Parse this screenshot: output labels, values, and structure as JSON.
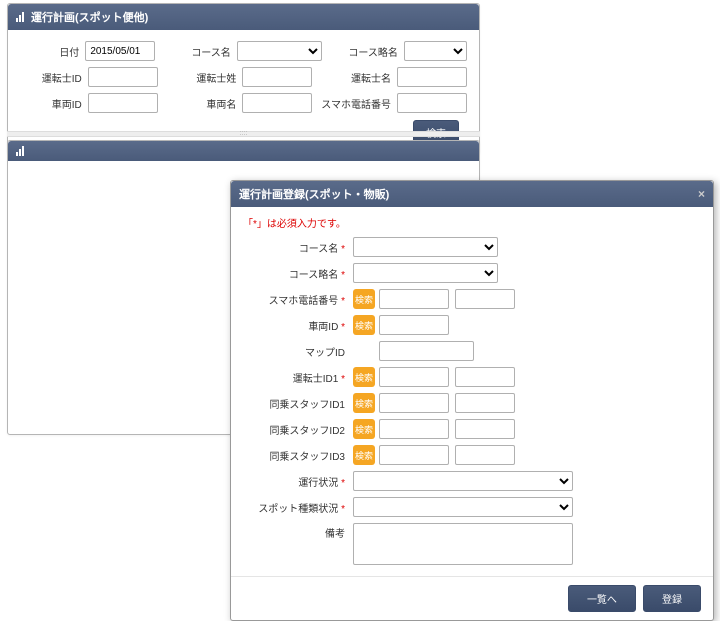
{
  "search_panel": {
    "title": "運行計画(スポット便他)",
    "date_lbl": "日付",
    "date_val": "2015/05/01",
    "course_name_lbl": "コース名",
    "course_alias_lbl": "コース略名",
    "driver_id_lbl": "運転士ID",
    "driver_surname_lbl": "運転士姓",
    "driver_given_lbl": "運転士名",
    "vehicle_id_lbl": "車両ID",
    "vehicle_name_lbl": "車両名",
    "phone_lbl": "スマホ電話番号",
    "search_btn": "検索"
  },
  "list_panel": {
    "title": ""
  },
  "dialog": {
    "title": "運行計画登録(スポット・物販)",
    "close": "×",
    "req_note": "「*」は必須入力です。",
    "course_name_lbl": "コース名",
    "course_alias_lbl": "コース略名",
    "phone_lbl": "スマホ電話番号",
    "vehicle_id_lbl": "車両ID",
    "map_id_lbl": "マップID",
    "driver_id1_lbl": "運転士ID1",
    "staff_id1_lbl": "同乗スタッフID1",
    "staff_id2_lbl": "同乗スタッフID2",
    "staff_id3_lbl": "同乗スタッフID3",
    "run_status_lbl": "運行状況",
    "spot_type_lbl": "スポット種類状況",
    "note_lbl": "備考",
    "ref_btn": "検索",
    "list_btn": "一覧へ",
    "register_btn": "登録",
    "asterisk": "*"
  }
}
